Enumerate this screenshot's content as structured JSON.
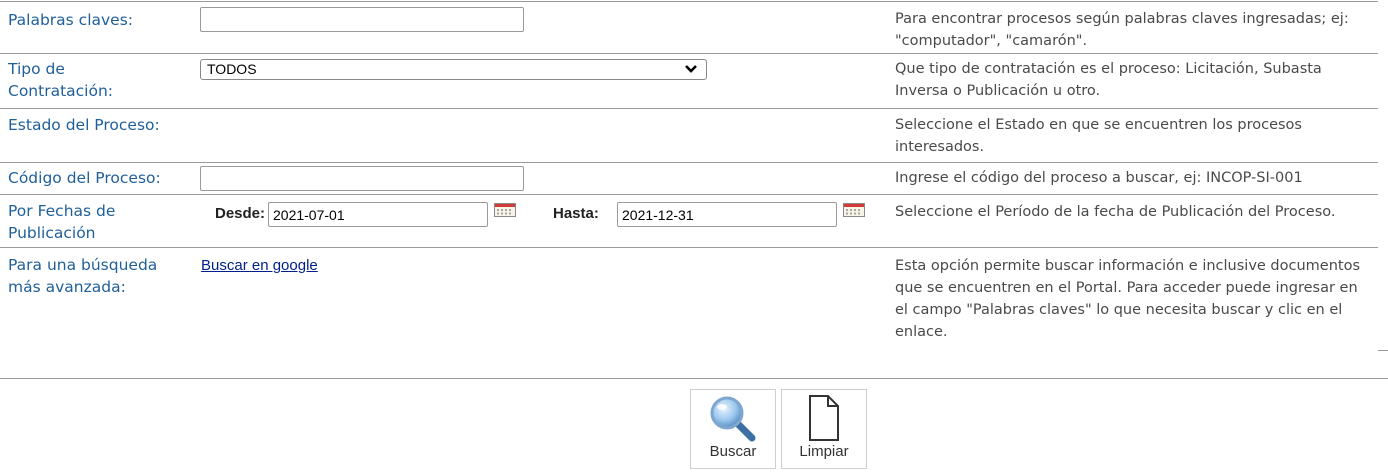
{
  "fields": {
    "keywords": {
      "label": "Palabras claves:",
      "value": "",
      "help": "Para encontrar procesos según palabras claves ingresadas; ej: \"computador\", \"camarón\"."
    },
    "contract_type": {
      "label_line1": "Tipo de",
      "label_line2": "Contratación:",
      "selected": "TODOS",
      "help": "Que tipo de contratación es el proceso: Licitación, Subasta Inversa o Publicación u otro."
    },
    "status": {
      "label": "Estado del Proceso:",
      "help": "Seleccione el Estado en que se encuentren los procesos interesados."
    },
    "code": {
      "label": "Código del Proceso:",
      "value": "",
      "help": "Ingrese el código del proceso a buscar, ej: INCOP-SI-001"
    },
    "dates": {
      "label_line1": "Por Fechas de",
      "label_line2": "Publicación",
      "from_label": "Desde:",
      "from_value": "2021-07-01",
      "to_label": "Hasta:",
      "to_value": "2021-12-31",
      "help": "Seleccione el Período de la fecha de Publicación del Proceso."
    },
    "advanced": {
      "label_line1": "Para una búsqueda",
      "label_line2": "más avanzada:",
      "link_text": "Buscar en google",
      "help": "Esta opción permite buscar información e inclusive documentos que se encuentren en el Portal. Para acceder puede ingresar en el campo \"Palabras claves\" lo que necesita buscar y clic en el enlace."
    }
  },
  "buttons": {
    "search": "Buscar",
    "clear": "Limpiar"
  },
  "colors": {
    "label": "#1f5f9a",
    "link": "#001f8a",
    "divider": "#9a9a9a"
  }
}
